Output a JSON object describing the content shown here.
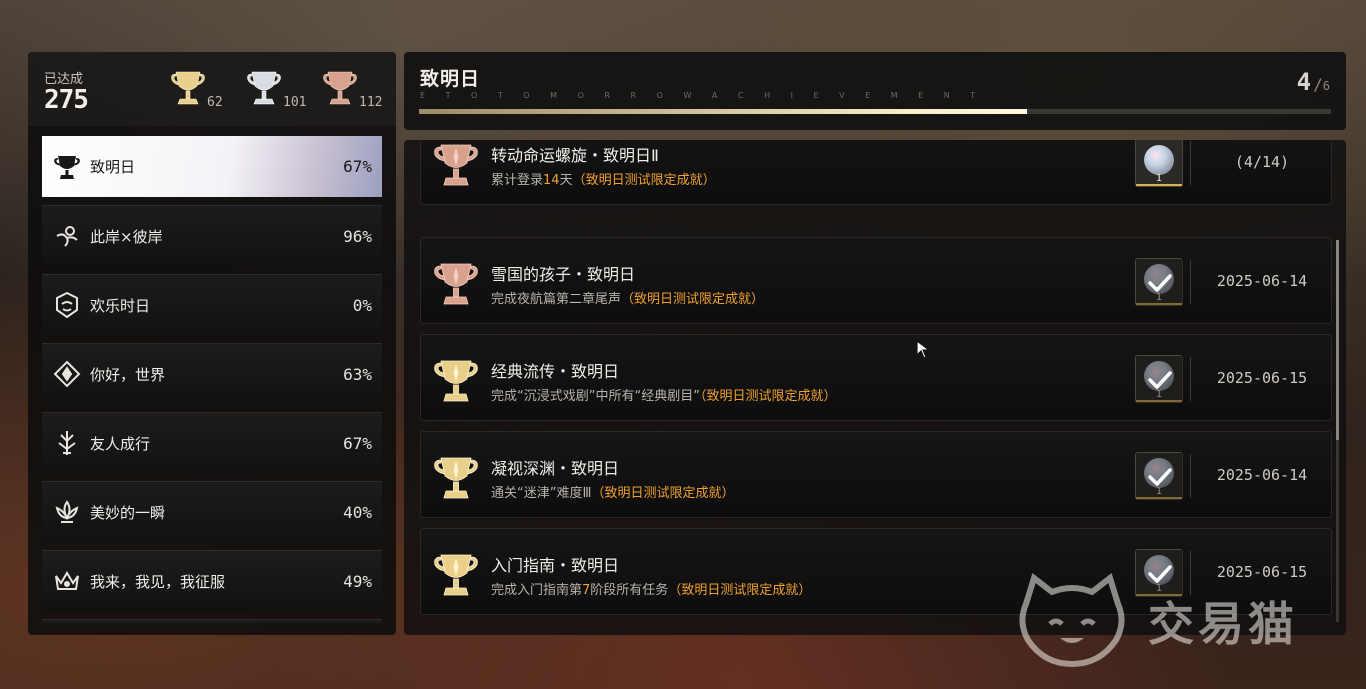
{
  "summary": {
    "label": "已达成",
    "count": "275",
    "gold": "62",
    "silver": "101",
    "bronze": "112"
  },
  "categories": [
    {
      "name": "致明日",
      "pct": "67%",
      "icon": "trophy-icon",
      "active": true
    },
    {
      "name": "此岸×彼岸",
      "pct": "96%",
      "icon": "swirl-icon"
    },
    {
      "name": "欢乐时日",
      "pct": "0%",
      "icon": "mask-icon"
    },
    {
      "name": "你好，世界",
      "pct": "63%",
      "icon": "compass-icon"
    },
    {
      "name": "友人成行",
      "pct": "67%",
      "icon": "crest-icon"
    },
    {
      "name": "美妙的一瞬",
      "pct": "40%",
      "icon": "lotus-icon"
    },
    {
      "name": "我来，我见，我征服",
      "pct": "49%",
      "icon": "crown-icon"
    }
  ],
  "header": {
    "title": "致明日",
    "subtitle": "E   T O   T O M O R R O W   A C H I E V E M E N T",
    "progress_current": "4",
    "progress_total": "6",
    "progress_fraction": 0.667
  },
  "achievements": [
    {
      "title": "转动命运螺旋・致明日Ⅱ",
      "desc_pre": "累计登录",
      "desc_num": "14",
      "desc_mid": "天",
      "desc_hl": "（致明日测试限定成就）",
      "tier": "bronze",
      "reward_qty": "1",
      "completed": false,
      "status": "(4/14)"
    },
    {
      "title": "雪国的孩子・致明日",
      "desc_pre": "完成夜航篇第二章尾声",
      "desc_num": "",
      "desc_mid": "",
      "desc_hl": "（致明日测试限定成就）",
      "tier": "bronze",
      "reward_qty": "1",
      "completed": true,
      "status": "2025-06-14"
    },
    {
      "title": "经典流传・致明日",
      "desc_pre": "完成“沉浸式戏剧”中所有“经典剧目”",
      "desc_num": "",
      "desc_mid": "",
      "desc_hl": "（致明日测试限定成就）",
      "tier": "gold",
      "reward_qty": "1",
      "completed": true,
      "status": "2025-06-15"
    },
    {
      "title": "凝视深渊・致明日",
      "desc_pre": "通关“迷津”难度Ⅲ",
      "desc_num": "",
      "desc_mid": "",
      "desc_hl": "（致明日测试限定成就）",
      "tier": "gold",
      "reward_qty": "1",
      "completed": true,
      "status": "2025-06-14"
    },
    {
      "title": "入门指南・致明日",
      "desc_pre": "完成入门指南第",
      "desc_num": "7",
      "desc_mid": "阶段所有任务",
      "desc_hl": "（致明日测试限定成就）",
      "tier": "gold",
      "reward_qty": "1",
      "completed": true,
      "status": "2025-06-15"
    }
  ],
  "watermark": {
    "text": "交易猫"
  },
  "colors": {
    "gold": "#e9cf8a",
    "silver": "#d8dde4",
    "bronze": "#d9a28f",
    "highlight": "#f0a030"
  }
}
